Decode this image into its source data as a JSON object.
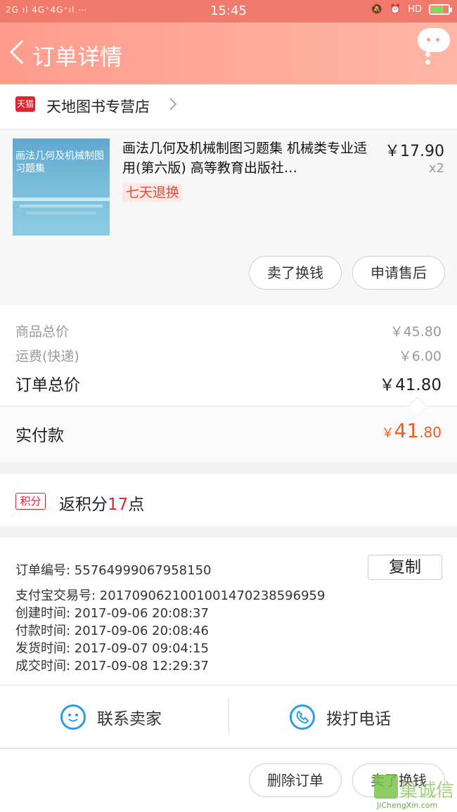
{
  "status_bar": {
    "signal": "2G ıl 4G⁺4G⁺ıl ⋯",
    "time": "15:45",
    "right": "HD"
  },
  "header": {
    "title": "订单详情"
  },
  "shop": {
    "badge": "天猫",
    "name": "天地图书专营店"
  },
  "product": {
    "cover_text": "画法几何及机械制图习题集",
    "title": "画法几何及机械制图习题集 机械类专业适用(第六版) 高等教育出版社…",
    "price": "￥17.90",
    "qty": "x2",
    "tag": "七天退换",
    "btn_sell": "卖了换钱",
    "btn_aftersale": "申请售后"
  },
  "summary": {
    "goods_label": "商品总价",
    "goods_value": "￥45.80",
    "shipping_label": "运费(快递)",
    "shipping_value": "￥6.00",
    "total_label": "订单总价",
    "total_value": "￥41.80"
  },
  "paid": {
    "label": "实付款",
    "currency": "￥",
    "integer": "41",
    "decimal": ".80"
  },
  "points": {
    "badge": "积分",
    "prefix": "返积分",
    "value": "17",
    "suffix": "点"
  },
  "order_info": {
    "order_no": "订单编号:   55764999067958150",
    "alipay_no": "支付宝交易号:   2017090621001001470238596959",
    "created": "创建时间:   2017-09-06  20:08:37",
    "paid_time": "付款时间:   2017-09-06  20:08:46",
    "shipped": "发货时间:   2017-09-07  09:04:15",
    "completed": "成交时间:   2017-09-08  12:29:37",
    "copy_label": "复制"
  },
  "contact": {
    "seller": "联系卖家",
    "call": "拨打电话"
  },
  "bottom": {
    "delete": "删除订单",
    "sell": "卖了换钱"
  },
  "watermark": {
    "text": "巢诚信",
    "url": "JiChengXin.com"
  },
  "colors": {
    "header": "#ff9c8c",
    "accent": "#e0242f",
    "price_orange": "#f05b22",
    "icon_blue": "#2a9ee0"
  }
}
